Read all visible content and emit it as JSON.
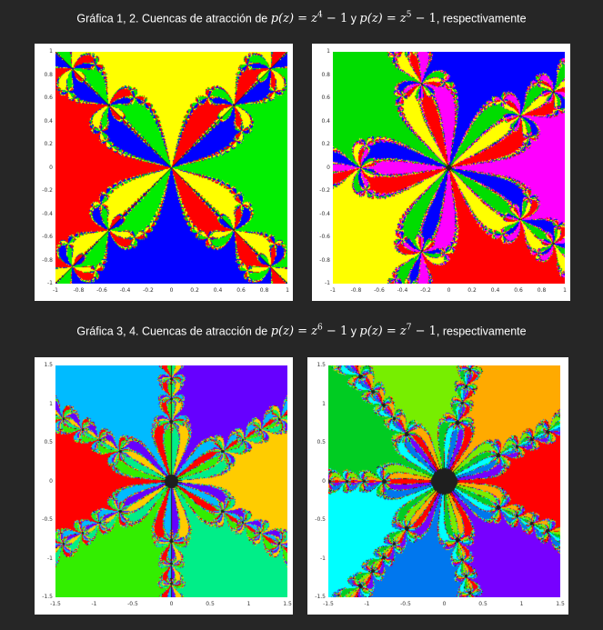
{
  "captions": [
    {
      "prefix": "Gráfica 1, 2. Cuencas de atracción de ",
      "expr1": "p(z) = z",
      "exp1": "4",
      "tail1": " − 1",
      "join": " y ",
      "expr2": "p(z) = z",
      "exp2": "5",
      "tail2": " − 1",
      "suffix": ", respectivamente"
    },
    {
      "prefix": "Gráfica 3, 4. Cuencas de atracción de ",
      "expr1": "p(z) = z",
      "exp1": "6",
      "tail1": " − 1",
      "join": " y ",
      "expr2": "p(z) = z",
      "exp2": "7",
      "tail2": " − 1",
      "suffix": ", respectivamente"
    }
  ],
  "plots": [
    {
      "name": "plot-z4",
      "degree": 4,
      "range": [
        -1,
        1
      ],
      "xticks": [
        "-1",
        "-0.8",
        "-0.6",
        "-0.4",
        "-0.2",
        "0",
        "0.2",
        "0.4",
        "0.6",
        "0.8",
        "1"
      ],
      "yticks": [
        "1",
        "0.8",
        "0.6",
        "0.4",
        "0.2",
        "0",
        "-0.2",
        "-0.4",
        "-0.6",
        "-0.8",
        "-1"
      ],
      "colors": [
        "#00ee00",
        "#ffff00",
        "#ff0000",
        "#0000ff"
      ]
    },
    {
      "name": "plot-z5",
      "degree": 5,
      "range": [
        -1,
        1
      ],
      "xticks": [
        "-1",
        "-0.8",
        "-0.6",
        "-0.4",
        "-0.2",
        "0",
        "0.2",
        "0.4",
        "0.6",
        "0.8",
        "1"
      ],
      "yticks": [
        "1",
        "0.8",
        "0.6",
        "0.4",
        "0.2",
        "0",
        "-0.2",
        "-0.4",
        "-0.6",
        "-0.8",
        "-1"
      ],
      "colors": [
        "#ff00ff",
        "#0000ff",
        "#00dd00",
        "#ffff00",
        "#ff0000"
      ]
    },
    {
      "name": "plot-z6",
      "degree": 6,
      "range": [
        -1.5,
        1.5
      ],
      "xticks": [
        "-1.5",
        "-1",
        "-0.5",
        "0",
        "0.5",
        "1",
        "1.5"
      ],
      "yticks": [
        "1.5",
        "1",
        "0.5",
        "0",
        "-0.5",
        "-1",
        "-1.5"
      ],
      "colors": [
        "#ffcc00",
        "#6600ff",
        "#00bbff",
        "#ff0000",
        "#33ee00",
        "#00ee88"
      ]
    },
    {
      "name": "plot-z7",
      "degree": 7,
      "range": [
        -1.5,
        1.5
      ],
      "xticks": [
        "-1.5",
        "-1",
        "-0.5",
        "0",
        "0.5",
        "1",
        "1.5"
      ],
      "yticks": [
        "1.5",
        "1",
        "0.5",
        "0",
        "-0.5",
        "-1",
        "-1.5"
      ],
      "colors": [
        "#ff0000",
        "#ffaa00",
        "#77ee00",
        "#00cc22",
        "#00ffff",
        "#0077ee",
        "#7700ff"
      ]
    }
  ]
}
